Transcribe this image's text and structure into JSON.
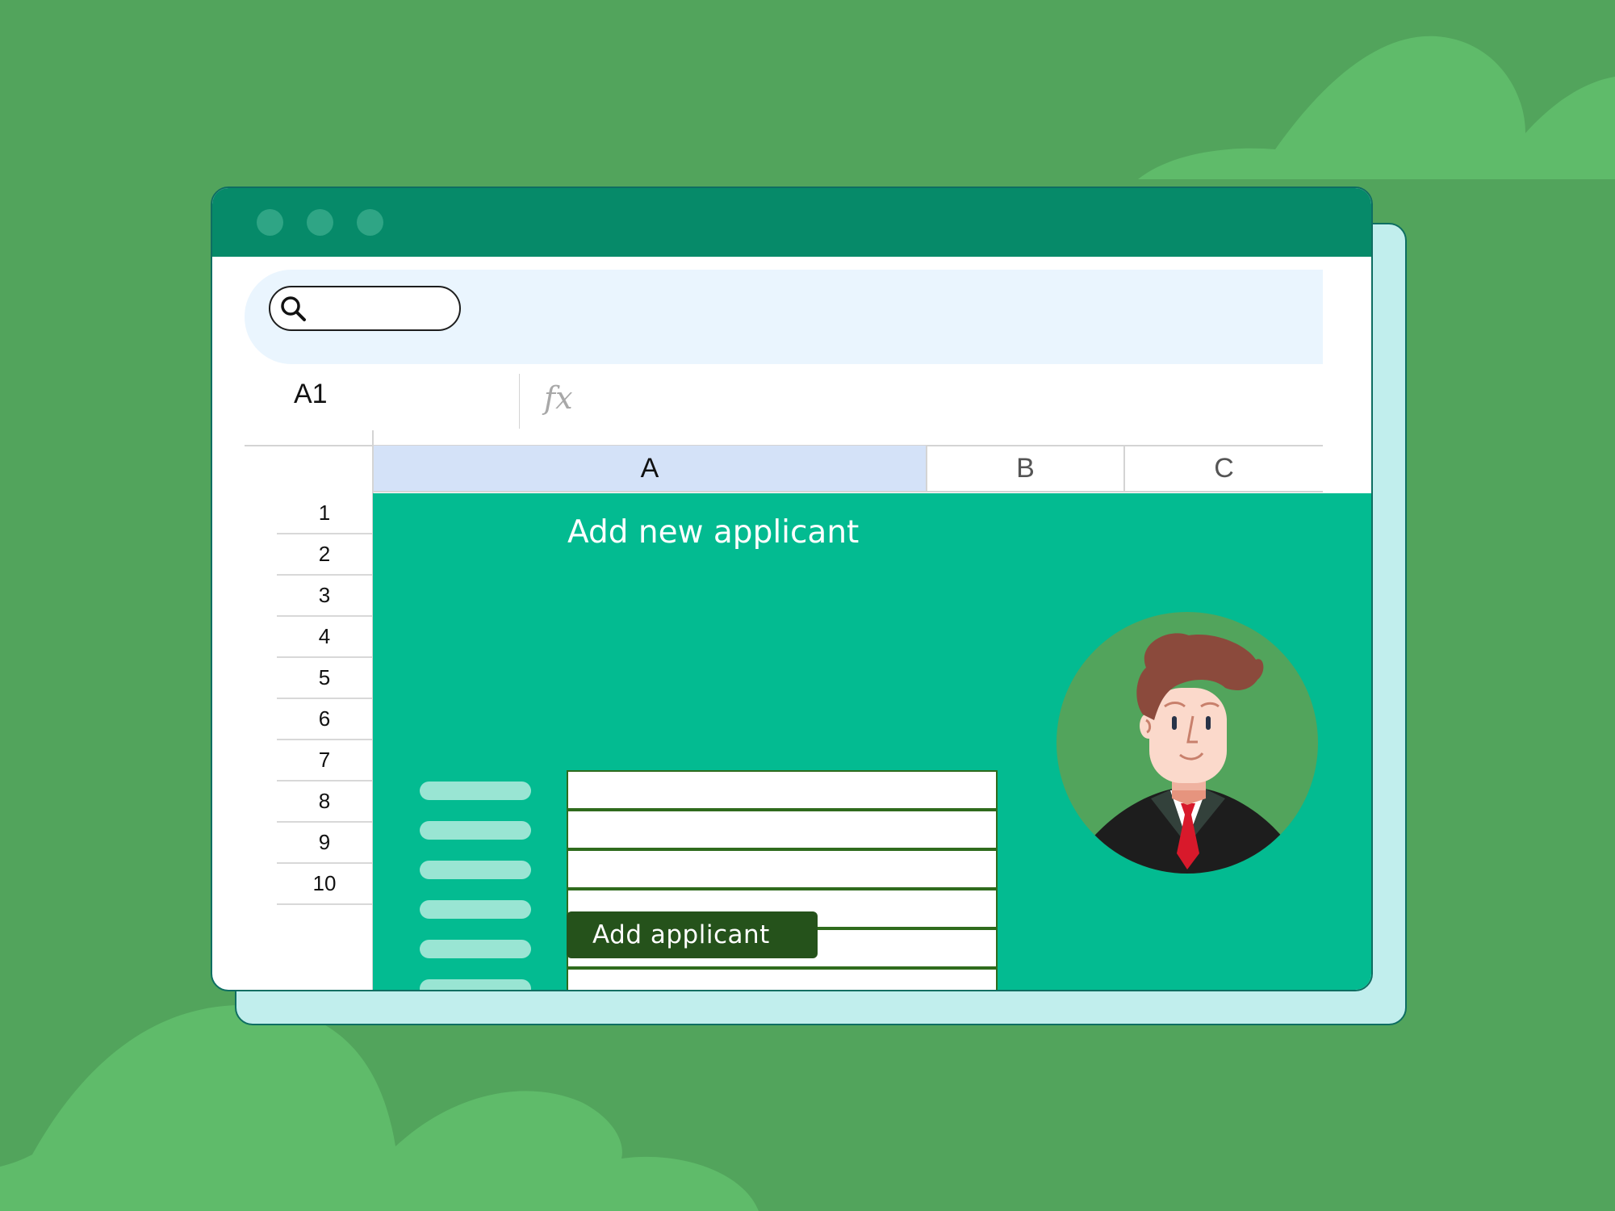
{
  "colors": {
    "background": "#52a45c",
    "bush": "#5fbb6a",
    "titlebar": "#068a69",
    "form_panel": "#03bb91",
    "button": "#25521b",
    "selected_column": "#d4e2f8",
    "progress": "#3aa3f1"
  },
  "icons": {
    "search": "search-icon",
    "formula": "fx-icon"
  },
  "formula_bar": {
    "cell_reference": "A1",
    "fx_label": "fx"
  },
  "columns": [
    {
      "label": "A",
      "selected": true
    },
    {
      "label": "B",
      "selected": false
    },
    {
      "label": "C",
      "selected": false
    }
  ],
  "rows": [
    "1",
    "2",
    "3",
    "4",
    "5",
    "6",
    "7",
    "8",
    "9",
    "10"
  ],
  "form": {
    "title": "Add new applicant",
    "field_count": 8,
    "submit_label": "Add applicant"
  }
}
